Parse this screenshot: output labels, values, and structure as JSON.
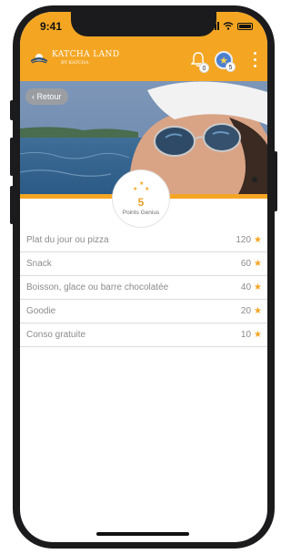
{
  "status": {
    "time": "9:41"
  },
  "header": {
    "brand_title": "KATCHA LAND",
    "brand_subtitle": "BY KATCHA",
    "notifications_count": "0",
    "stars_count": "5"
  },
  "hero": {
    "back_label": "Retour"
  },
  "points": {
    "value": "5",
    "label": "Points Genius"
  },
  "rewards": [
    {
      "name": "Plat du jour ou pizza",
      "points": "120"
    },
    {
      "name": "Snack",
      "points": "60"
    },
    {
      "name": "Boisson, glace ou barre chocolatée",
      "points": "40"
    },
    {
      "name": "Goodie",
      "points": "20"
    },
    {
      "name": "Conso gratuite",
      "points": "10"
    }
  ],
  "colors": {
    "accent": "#f4a623",
    "star": "#f4a623",
    "text": "#8b8b8b"
  },
  "icons": [
    "bell-icon",
    "star-icon",
    "more-icon",
    "back-chevron-icon",
    "logo-icon"
  ]
}
